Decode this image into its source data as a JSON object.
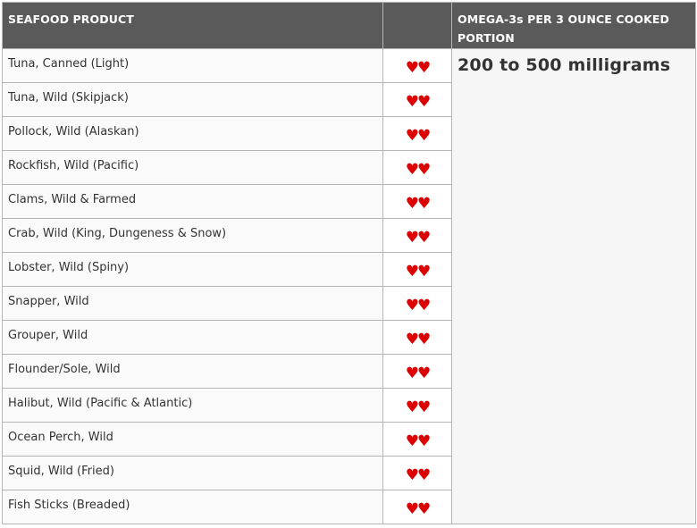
{
  "table": {
    "headers": {
      "product": "SEAFOOD PRODUCT",
      "rating": "",
      "omega": "OMEGA-3s PER 3 OUNCE COOKED PORTION"
    },
    "omega_amount": "200 to 500 milligrams",
    "rating_symbol": "♥♥",
    "rating_color": "#dd0000",
    "header_bg": "#5a5a5a",
    "rows": [
      {
        "product": "Tuna, Canned (Light)"
      },
      {
        "product": "Tuna, Wild (Skipjack)"
      },
      {
        "product": "Pollock, Wild (Alaskan)"
      },
      {
        "product": "Rockfish, Wild (Pacific)"
      },
      {
        "product": "Clams, Wild & Farmed"
      },
      {
        "product": "Crab, Wild (King, Dungeness & Snow)"
      },
      {
        "product": "Lobster, Wild (Spiny)"
      },
      {
        "product": "Snapper, Wild"
      },
      {
        "product": "Grouper, Wild"
      },
      {
        "product": "Flounder/Sole, Wild"
      },
      {
        "product": "Halibut, Wild (Pacific & Atlantic)"
      },
      {
        "product": "Ocean Perch, Wild"
      },
      {
        "product": "Squid, Wild (Fried)"
      },
      {
        "product": "Fish Sticks (Breaded)"
      }
    ]
  }
}
